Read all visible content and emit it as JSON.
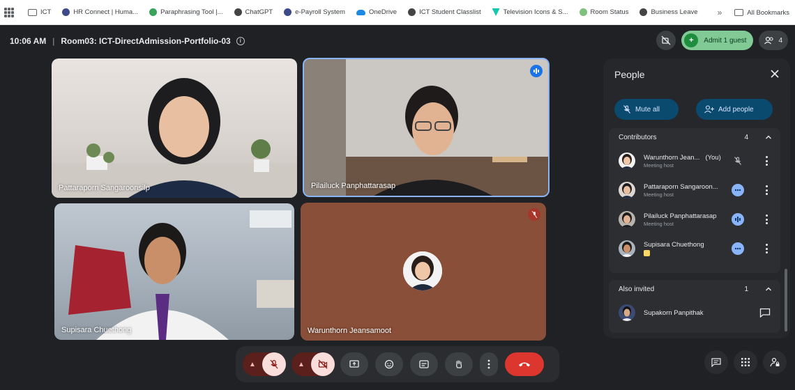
{
  "bookmarks": {
    "items": [
      {
        "label": "ICT",
        "icon": "folder-icon",
        "color": "#5f6368"
      },
      {
        "label": "HR Connect | Huma...",
        "icon": "globe-icon",
        "color": "#3c4a8a"
      },
      {
        "label": "Paraphrasing Tool |...",
        "icon": "quillbot-icon",
        "color": "#3aa35b"
      },
      {
        "label": "ChatGPT",
        "icon": "openai-icon",
        "color": "#444444"
      },
      {
        "label": "e-Payroll System",
        "icon": "globe-icon",
        "color": "#3c4a8a"
      },
      {
        "label": "OneDrive",
        "icon": "cloud-icon",
        "color": "#1e88e5"
      },
      {
        "label": "ICT Student Classlist",
        "icon": "globe-icon",
        "color": "#444444"
      },
      {
        "label": "Television Icons & S...",
        "icon": "flaticon-icon",
        "color": "#16c7b0"
      },
      {
        "label": "Room Status",
        "icon": "globe-icon",
        "color": "#7ec07e"
      },
      {
        "label": "Business Leave",
        "icon": "globe-icon",
        "color": "#444444"
      }
    ],
    "more": "»",
    "all_bookmarks": "All Bookmarks"
  },
  "header": {
    "time": "10:06 AM",
    "separator": "|",
    "meeting_title": "Room03: ICT-DirectAdmission-Portfolio-03",
    "admit_label": "Admit 1 guest",
    "people_count": "4"
  },
  "tiles": [
    {
      "name": "Pattaraporn Sangaroonsilp"
    },
    {
      "name": "Pilailuck Panphattarasap"
    },
    {
      "name": "Supisara Chuethong"
    },
    {
      "name": "Warunthorn Jeansamoot"
    }
  ],
  "panel": {
    "title": "People",
    "mute_all": "Mute all",
    "add_people": "Add people",
    "contributors": {
      "label": "Contributors",
      "count": "4",
      "people": [
        {
          "name": "Warunthorn Jean...",
          "you": "(You)",
          "sub": "Meeting host"
        },
        {
          "name": "Pattaraporn Sangaroon...",
          "sub": "Meeting host"
        },
        {
          "name": "Pilailuck Panphattarasap",
          "sub": "Meeting host"
        },
        {
          "name": "Supisara Chuethong",
          "sub": ""
        }
      ]
    },
    "also_invited": {
      "label": "Also invited",
      "count": "1",
      "people": [
        {
          "name": "Supakorn Panpithak"
        }
      ]
    }
  },
  "colors": {
    "background": "#202124",
    "accent_blue": "#8ab4f8",
    "admit_green": "#81c995",
    "end_call_red": "#dc362e",
    "mic_off_red": "#5b1f1c"
  }
}
